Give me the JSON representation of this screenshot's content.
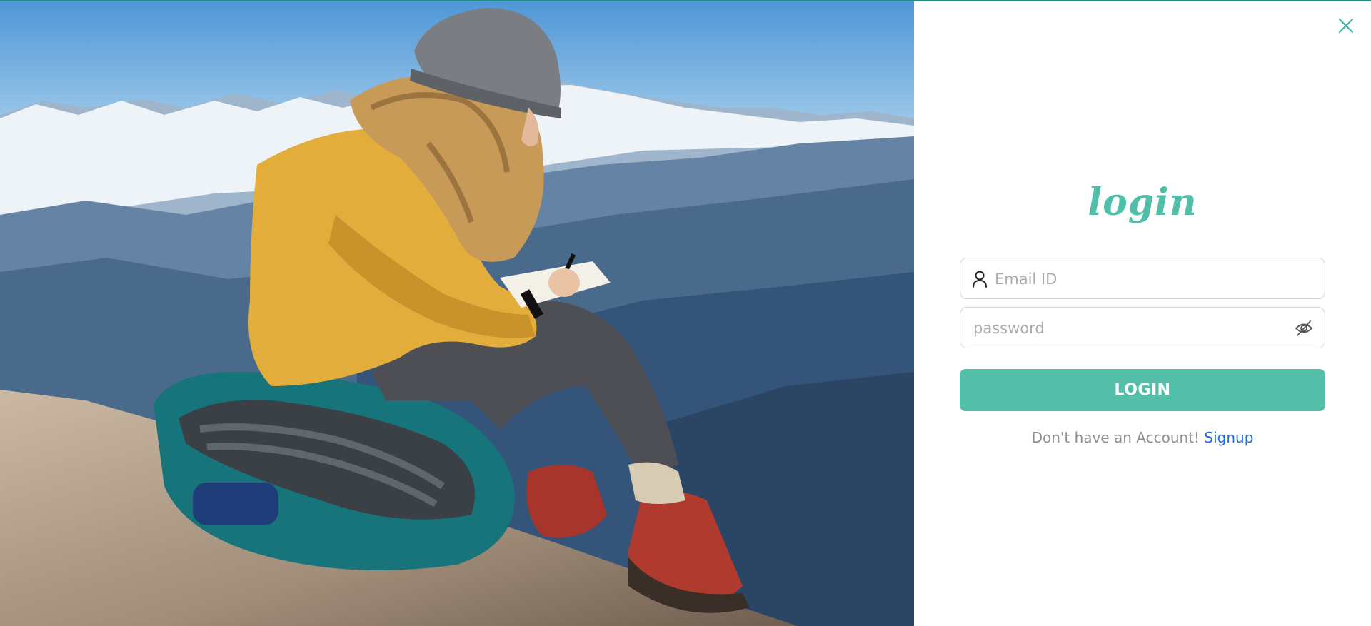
{
  "photo": {
    "description_icon": "hiker-on-mountain-photo"
  },
  "close": {
    "icon": "close-icon"
  },
  "login": {
    "title": "login",
    "email_placeholder": "Email ID",
    "email_value": "",
    "password_placeholder": "password",
    "password_value": "",
    "button_label": "LOGIN",
    "signup_prompt": "Don't have an Account!",
    "signup_link": "Signup"
  },
  "colors": {
    "accent": "#55c0aa",
    "title": "#4fbfaa",
    "link": "#1d6fe0",
    "close": "#3fb3a0"
  }
}
